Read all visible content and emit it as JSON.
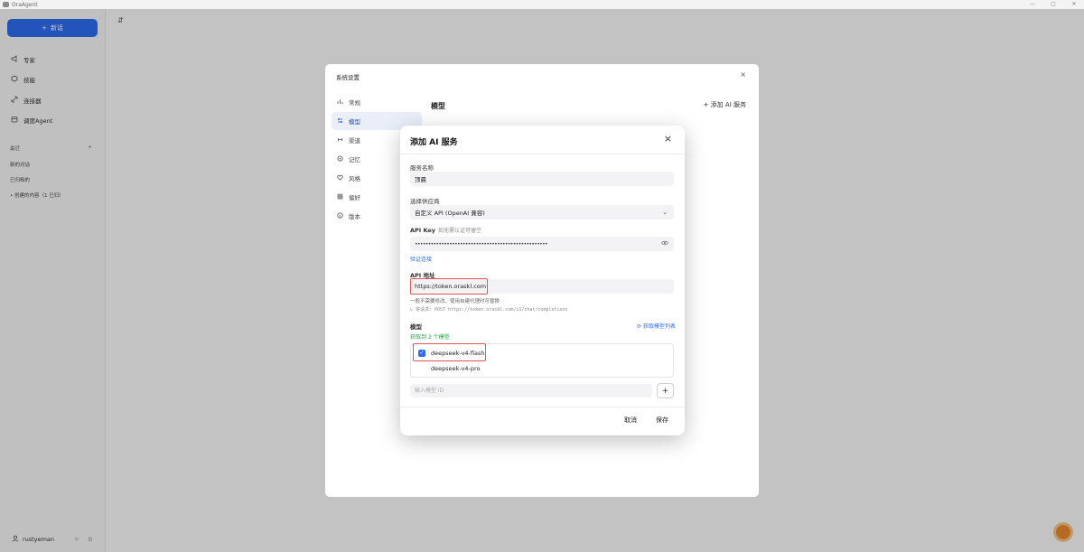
{
  "window": {
    "title": "OraAgent",
    "controls": [
      "—",
      "▢",
      "✕"
    ]
  },
  "sidebar": {
    "new_chat_label": "新话",
    "nav": [
      {
        "icon": "megaphone-icon",
        "label": "专家"
      },
      {
        "icon": "cube-icon",
        "label": "技能"
      },
      {
        "icon": "link-icon",
        "label": "连接器"
      },
      {
        "icon": "calendar-icon",
        "label": "调度Agent"
      }
    ],
    "section_label": "最近",
    "section_action": "+",
    "recent": [
      "新的对话",
      "已归档的",
      "• 创建的内容（1 已归）"
    ],
    "user": {
      "name": "rustyeman"
    }
  },
  "main": {
    "sidebar_toggle": "⇵"
  },
  "settings": {
    "title": "系统设置",
    "close": "×",
    "nav": [
      {
        "icon": "bar-chart-icon",
        "label": "常规"
      },
      {
        "icon": "model-icon",
        "label": "模型",
        "active": true
      },
      {
        "icon": "connector-icon",
        "label": "渠道"
      },
      {
        "icon": "memory-icon",
        "label": "记忆"
      },
      {
        "icon": "heart-icon",
        "label": "风格"
      },
      {
        "icon": "grid-icon",
        "label": "偏好"
      },
      {
        "icon": "info-icon",
        "label": "版本"
      }
    ],
    "page_title": "模型",
    "add_service": "+ 添加 AI 服务"
  },
  "dialog": {
    "title": "添加 AI 服务",
    "close": "×",
    "service_name": {
      "label": "服务名称",
      "value": "顶晨"
    },
    "provider": {
      "label": "选择供应商",
      "value": "自定义 API (OpenAI 兼容)"
    },
    "api_key": {
      "label": "API Key",
      "hint": "如无需认证可留空",
      "value": "••••••••••••••••••••••••••••••••••••••••••••••••••"
    },
    "verify_link": "验证连接",
    "api_url": {
      "label": "API 地址",
      "value": "https://token.oraskl.com"
    },
    "api_url_note": "一般不需要修改，使用自建代理时可替换",
    "api_url_resolved": "↳ 将请求: POST https://token.oraskl.com/v1/chat/completions",
    "models": {
      "label": "模型",
      "fetch_link": "⟳ 获取模型列表",
      "fetched_note": "获取到 2 个模型",
      "items": [
        {
          "name": "deepseek-v4-flash",
          "checked": true
        },
        {
          "name": "deepseek-v4-pro",
          "checked": false
        }
      ],
      "input_placeholder": "输入模型 ID",
      "add_button": "+"
    },
    "cancel": "取消",
    "save": "保存"
  }
}
